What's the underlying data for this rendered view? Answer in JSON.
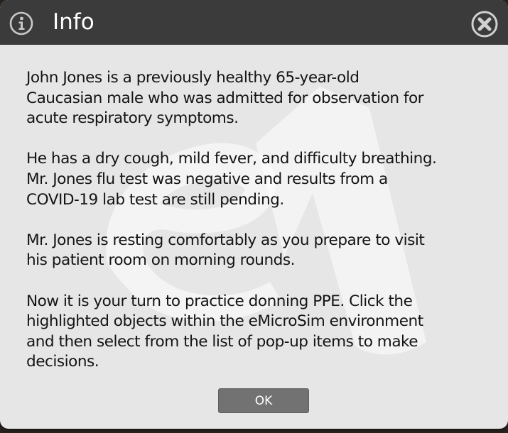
{
  "dialog": {
    "title": "Info",
    "info_icon": "info-icon",
    "close_icon": "close-x-circle-icon",
    "watermark": "emicrosim-logo-watermark",
    "paragraphs": [
      "John Jones is a previously healthy 65-year-old\nCaucasian male who was admitted for observation for\nacute respiratory symptoms.",
      "He has a dry cough, mild fever, and difficulty breathing.\nMr. Jones flu test was negative and results from a\nCOVID-19 lab test are still pending.",
      "Mr. Jones is resting comfortably as you prepare to visit\nhis patient room on morning rounds.",
      "Now it is your turn to practice donning PPE. Click the\nhighlighted objects within the eMicroSim environment\nand then select from the list of pop-up items to make\ndecisions."
    ],
    "ok_label": "OK"
  },
  "colors": {
    "titlebar": "#3b3b3b",
    "body": "#e6e6e6",
    "button": "#727272",
    "text": "#141414"
  }
}
